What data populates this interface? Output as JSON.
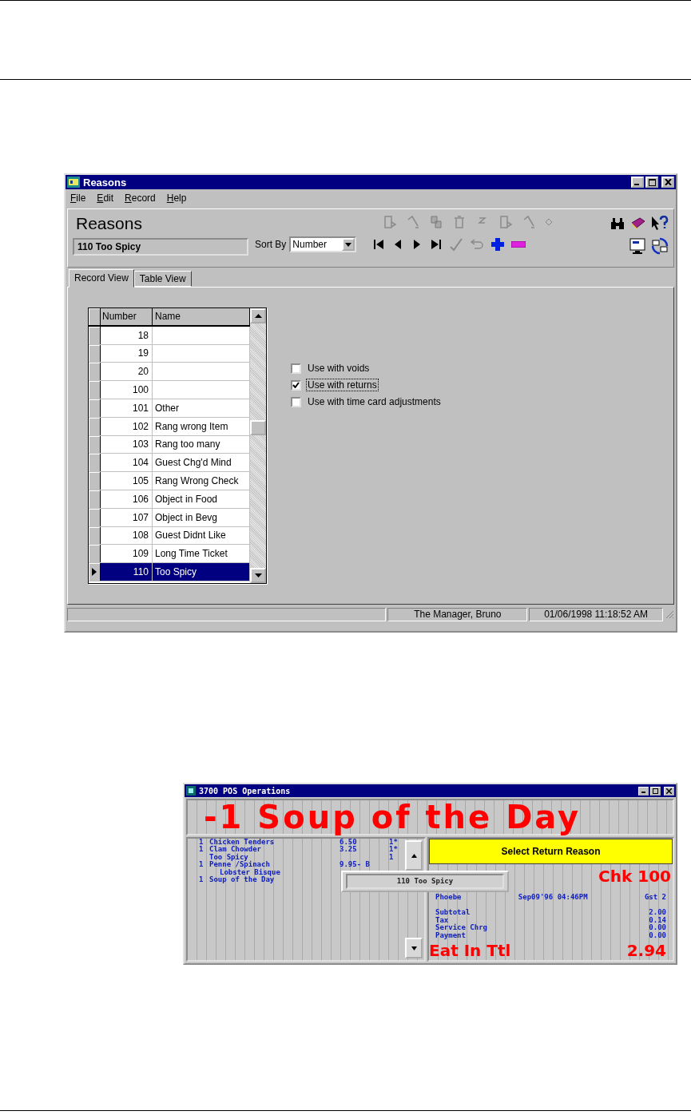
{
  "reasons_window": {
    "title": "Reasons",
    "menu": [
      {
        "label": "File"
      },
      {
        "label": "Edit"
      },
      {
        "label": "Record"
      },
      {
        "label": "Help"
      }
    ],
    "heading": "Reasons",
    "current_record": "110 Too Spicy",
    "sort_by_label": "Sort By",
    "sort_by_value": "Number",
    "tabs": [
      {
        "label": "Record View",
        "selected": true
      },
      {
        "label": "Table View",
        "selected": false
      }
    ],
    "grid": {
      "columns": [
        "Number",
        "Name"
      ],
      "rows": [
        {
          "number": "18",
          "selected": false
        },
        {
          "number": "19",
          "selected": false
        },
        {
          "number": "20",
          "selected": false
        },
        {
          "number": "100",
          "selected": false
        },
        {
          "number": "101",
          "name": "Other",
          "selected": false
        },
        {
          "number": "102",
          "name": "Rang wrong Item",
          "selected": false
        },
        {
          "number": "103",
          "name": "Rang too many",
          "selected": false
        },
        {
          "number": "104",
          "name": "Guest Chg'd Mind",
          "selected": false
        },
        {
          "number": "105",
          "name": "Rang Wrong Check",
          "selected": false
        },
        {
          "number": "106",
          "name": "Object in Food",
          "selected": false
        },
        {
          "number": "107",
          "name": "Object in Bevg",
          "selected": false
        },
        {
          "number": "108",
          "name": "Guest Didnt Like",
          "selected": false
        },
        {
          "number": "109",
          "name": "Long Time Ticket",
          "selected": false
        },
        {
          "number": "110",
          "name": "Too Spicy",
          "selected": true
        }
      ]
    },
    "options": [
      {
        "label": "Use with voids",
        "checked": false,
        "focused": false
      },
      {
        "label": "Use with returns",
        "checked": true,
        "focused": true
      },
      {
        "label": "Use with time card adjustments",
        "checked": false,
        "focused": false
      }
    ],
    "status_bar": [
      "The Manager, Bruno",
      "01/06/1998 11:18:52 AM"
    ]
  },
  "pos_window": {
    "title": "3700 POS Operations",
    "banner": "-1 Soup of the Day",
    "check_lines": [
      {
        "kind": "item",
        "qty": "1",
        "item": "Chicken Tenders",
        "price": "6.50",
        "flag": "1*"
      },
      {
        "kind": "item",
        "qty": "1",
        "item": "Clam Chowder",
        "price": "3.25",
        "flag": "1*"
      },
      {
        "kind": "reason",
        "item": "Too Spicy",
        "flag": "1"
      },
      {
        "kind": "item",
        "qty": "1",
        "item": "Penne /Spinach",
        "price": "9.95- B"
      },
      {
        "kind": "modifier",
        "item": "Lobster Bisque"
      },
      {
        "kind": "item",
        "qty": "1",
        "item": "Soup of the Day"
      }
    ],
    "prompt": "Select Return Reason",
    "popup": "110 Too Spicy",
    "check_number": "Chk 100",
    "server": "Phoebe",
    "date": "Sep09'96 04:46PM",
    "guests": "Gst 2",
    "totals": [
      {
        "label": "Subtotal",
        "value": "2.00"
      },
      {
        "label": "Tax",
        "value": "0.14"
      },
      {
        "label": "Service Chrg",
        "value": "0.00"
      },
      {
        "label": "Payment",
        "value": "0.00"
      }
    ],
    "total_label": "Eat In Ttl",
    "total_value": "2.94"
  }
}
